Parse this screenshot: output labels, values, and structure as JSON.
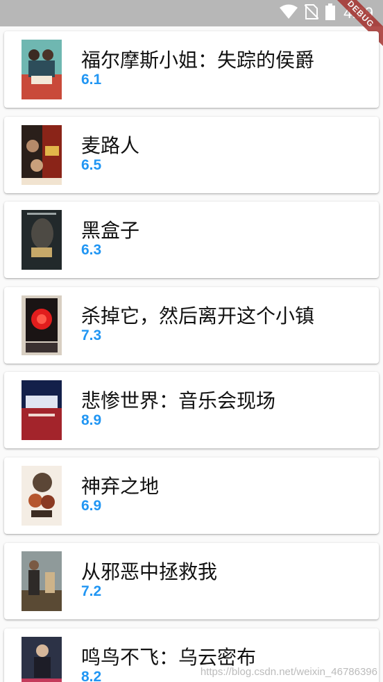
{
  "status_bar": {
    "time": "4:29",
    "icons": [
      "wifi-icon",
      "no-sim-icon",
      "battery-icon"
    ],
    "debug_label": "DEBUG"
  },
  "movies": [
    {
      "title": "福尔摩斯小姐：失踪的侯爵",
      "rating": "6.1"
    },
    {
      "title": "麦路人",
      "rating": "6.5"
    },
    {
      "title": "黑盒子",
      "rating": "6.3"
    },
    {
      "title": "杀掉它，然后离开这个小镇",
      "rating": "7.3"
    },
    {
      "title": "悲惨世界：音乐会现场",
      "rating": "8.9"
    },
    {
      "title": "神弃之地",
      "rating": "6.9"
    },
    {
      "title": "从邪恶中拯救我",
      "rating": "7.2"
    },
    {
      "title": "鸣鸟不飞：乌云密布",
      "rating": "8.2"
    }
  ],
  "watermark": "https://blog.csdn.net/weixin_46786396",
  "colors": {
    "rating": "#2196f3",
    "status_bar": "#b7b7b7",
    "debug_banner": "#a5322e"
  }
}
